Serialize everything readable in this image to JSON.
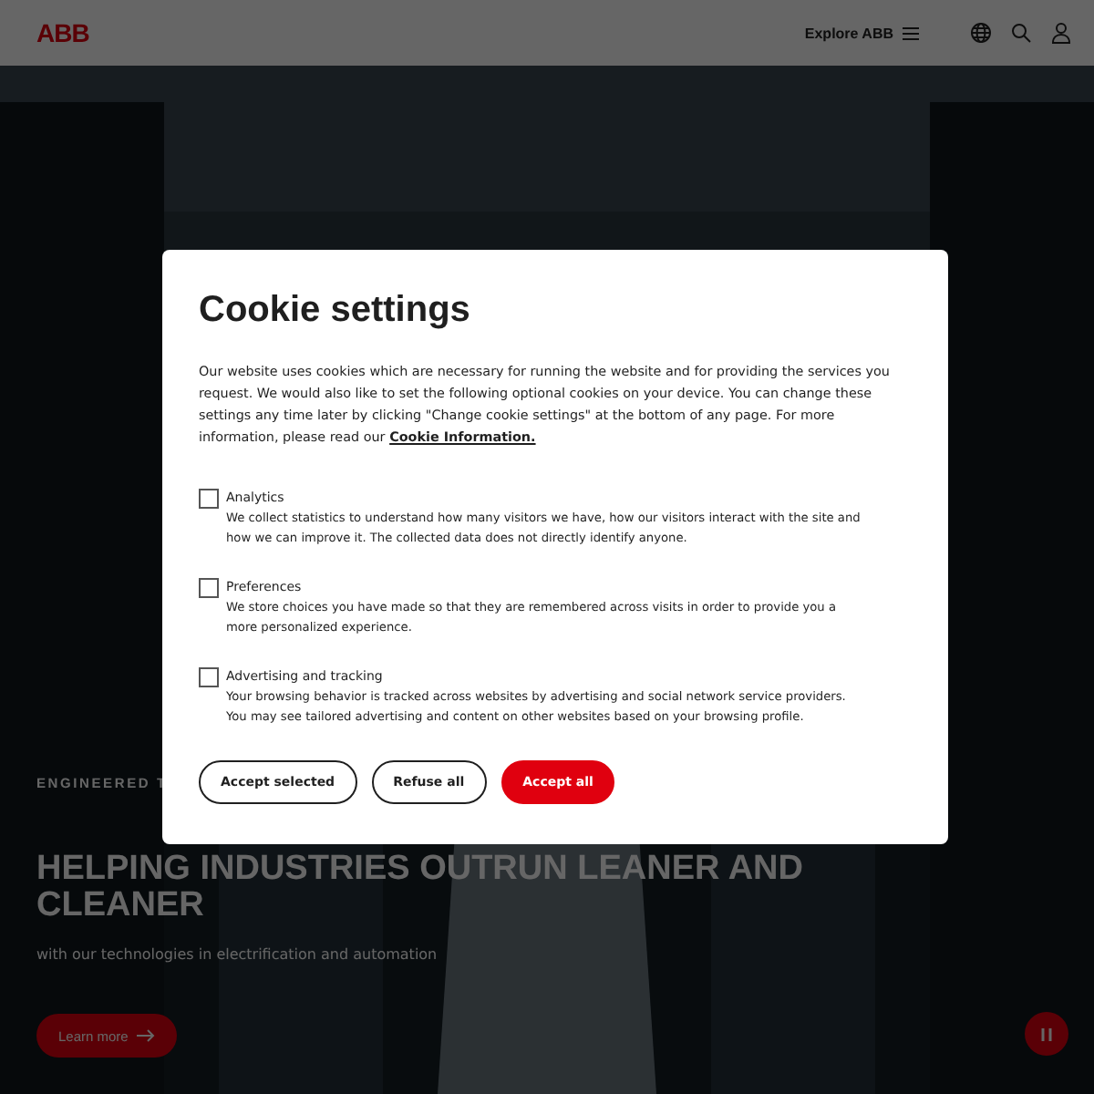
{
  "header": {
    "logo": "ABB",
    "explore": "Explore ABB"
  },
  "hero": {
    "kind": "picture",
    "tagline": "ENGINEERED T",
    "headline": "HELPING INDUSTRIES OUTRUN LEANER AND CLEANER",
    "subtitle": "with our technologies in electrification and automation",
    "cta": "Learn more"
  },
  "dialog": {
    "title": "Cookie settings",
    "intro": "Our website uses cookies which are necessary for running the website and for providing the services you request. We would also like to set the following optional cookies on your device. You can change these settings any time later by clicking \"Change cookie settings\" at the bottom of any page. For more information, please read our",
    "link": "Cookie Information.",
    "categories": [
      {
        "label": "Analytics",
        "description": "We collect statistics to understand how many visitors we have, how our visitors interact with the site and how we can improve it. The collected data does not directly identify anyone.",
        "checked": false
      },
      {
        "label": "Preferences",
        "description": "We store choices you have made so that they are remembered across visits in order to provide you a more personalized experience.",
        "checked": false
      },
      {
        "label": "Advertising and tracking",
        "description": "Your browsing behavior is tracked across websites by advertising and social network service providers. You may see tailored advertising and content on other websites based on your browsing profile.",
        "checked": false
      }
    ],
    "buttons": [
      {
        "label": "Accept selected",
        "kind": "outline"
      },
      {
        "label": "Refuse all",
        "kind": "outline"
      },
      {
        "label": "Accept all",
        "kind": "primary"
      }
    ]
  }
}
